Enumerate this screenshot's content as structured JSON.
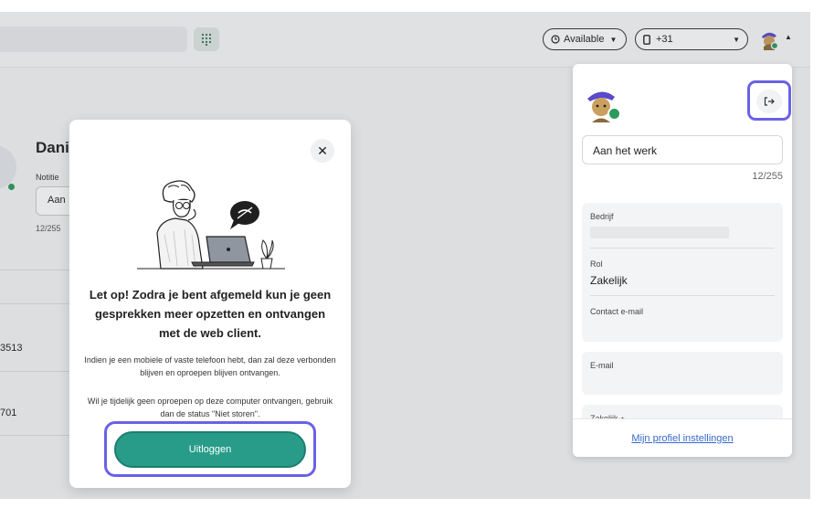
{
  "topbar": {
    "status_label": "Available",
    "phone_label": "+31"
  },
  "contact": {
    "name": "Dani",
    "note_label": "Notitie",
    "note_value": "Aan",
    "note_count": "12/255",
    "number_1": "3513",
    "number_2": "701"
  },
  "modal": {
    "title": "Let op! Zodra je bent afgemeld kun je geen gesprekken meer opzetten en ontvangen met de web client.",
    "paragraph_1": "Indien je een mobiele of vaste telefoon hebt, dan zal deze verbonden blijven en oproepen blijven ontvangen.",
    "paragraph_2": "Wil je tijdelijk geen oproepen op deze computer ontvangen, gebruik dan de status \"Niet storen\".",
    "logout_label": "Uitloggen",
    "close_glyph": "✕"
  },
  "profile": {
    "status_value": "Aan het werk",
    "status_count": "12/255",
    "company_label": "Bedrijf",
    "role_label": "Rol",
    "role_value": "Zakelijk",
    "contact_email_label": "Contact e-mail",
    "email_label": "E-mail",
    "business_label": "Zakelijk ⭑",
    "footer_link": "Mijn profiel instellingen"
  },
  "colors": {
    "accent_ring": "#6a61e6",
    "logout_button": "#289c89",
    "presence_green": "#2c9a5a",
    "link": "#3569c9"
  },
  "icons": [
    "dialpad-icon",
    "clock-icon",
    "phone-icon",
    "avatar-icon",
    "logout-icon",
    "close-icon"
  ]
}
